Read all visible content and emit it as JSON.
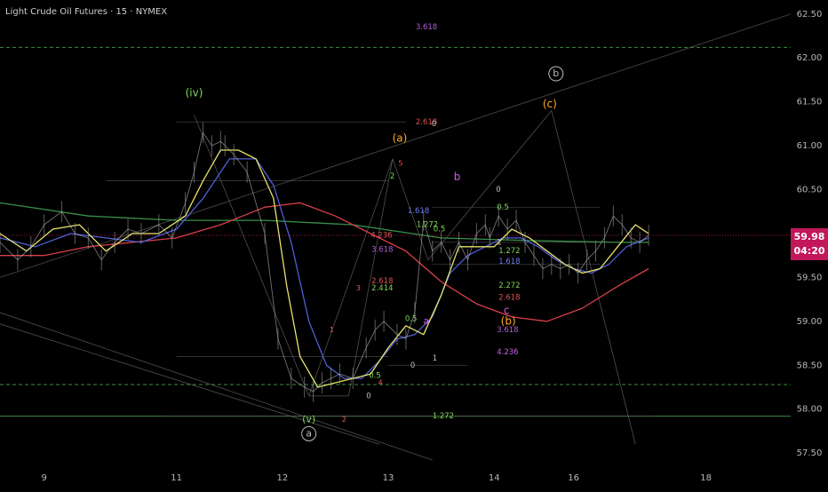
{
  "header": {
    "title": "Light Crude Oil Futures · 15 · NYMEX"
  },
  "price_tag": {
    "price": "59.98",
    "countdown": "04:20",
    "value": 59.98,
    "color": "#c2185b"
  },
  "colors": {
    "background": "#000000",
    "price": "#cfcfcf",
    "fast_ma": "#e8e36a",
    "mid_ma": "#4f5fd6",
    "slow_ma": "#d8404a",
    "long_ma": "#3a8f4a",
    "dashed_level": "#4caf50",
    "label_green": "#7ed957",
    "label_orange": "#ffa726",
    "label_pink": "#d05ce8",
    "label_red": "#ff5252",
    "label_gray": "#bdbdbd"
  },
  "chart_data": {
    "type": "line",
    "x_ticks": [
      "9",
      "11",
      "12",
      "13",
      "14",
      "16",
      "18"
    ],
    "x_tick_pos": [
      0.5,
      2.0,
      3.2,
      4.4,
      5.6,
      6.5,
      8.0
    ],
    "xlim": [
      0,
      8.96
    ],
    "ylim": [
      57.4,
      62.66
    ],
    "y_ticks": [
      "62.50",
      "62.00",
      "61.50",
      "61.00",
      "60.50",
      "59.50",
      "59.00",
      "58.50",
      "58.00",
      "57.50"
    ],
    "y_tick_values": [
      62.5,
      62.0,
      61.5,
      61.0,
      60.5,
      59.5,
      59.0,
      58.5,
      58.0,
      57.5
    ],
    "price": {
      "x": [
        0,
        0.2,
        0.35,
        0.5,
        0.7,
        0.85,
        1.0,
        1.15,
        1.3,
        1.45,
        1.6,
        1.8,
        1.95,
        2.1,
        2.2,
        2.3,
        2.4,
        2.5,
        2.55,
        2.65,
        2.8,
        3.0,
        3.15,
        3.3,
        3.45,
        3.55,
        3.65,
        3.75,
        3.85,
        4.0,
        4.15,
        4.25,
        4.35,
        4.5,
        4.6,
        4.7,
        4.8,
        4.9,
        5.0,
        5.1,
        5.2,
        5.3,
        5.4,
        5.5,
        5.55,
        5.65,
        5.75,
        5.85,
        5.95,
        6.05,
        6.15,
        6.25,
        6.35,
        6.45,
        6.55,
        6.65,
        6.75,
        6.85,
        6.95,
        7.05,
        7.15,
        7.25,
        7.35
      ],
      "y": [
        59.9,
        59.7,
        59.85,
        60.1,
        60.25,
        60.0,
        59.95,
        59.7,
        59.9,
        60.05,
        60.0,
        60.1,
        59.95,
        60.35,
        60.7,
        61.15,
        61.0,
        61.05,
        61.0,
        60.9,
        60.7,
        60.0,
        58.8,
        58.35,
        58.25,
        58.2,
        58.3,
        58.35,
        58.4,
        58.35,
        58.7,
        58.9,
        59.0,
        58.85,
        58.8,
        59.1,
        60.15,
        59.8,
        59.9,
        59.7,
        59.9,
        59.7,
        60.0,
        60.1,
        59.95,
        60.2,
        60.05,
        60.15,
        59.9,
        59.75,
        59.6,
        59.65,
        59.6,
        59.65,
        59.55,
        59.7,
        59.8,
        59.95,
        60.2,
        60.1,
        59.95,
        59.9,
        59.98
      ]
    },
    "series": [
      {
        "x": [
          0,
          0.3,
          0.6,
          0.9,
          1.2,
          1.5,
          1.8,
          2.1,
          2.3,
          2.5,
          2.7,
          2.9,
          3.1,
          3.25,
          3.4,
          3.6,
          3.8,
          4.0,
          4.2,
          4.4,
          4.6,
          4.8,
          5.0,
          5.2,
          5.4,
          5.6,
          5.8,
          6.0,
          6.2,
          6.4,
          6.6,
          6.8,
          7.0,
          7.2,
          7.35
        ],
        "y": [
          60.0,
          59.8,
          60.05,
          60.1,
          59.8,
          60.0,
          60.0,
          60.2,
          60.6,
          60.95,
          60.95,
          60.85,
          60.4,
          59.4,
          58.6,
          58.25,
          58.3,
          58.35,
          58.4,
          58.7,
          58.95,
          58.85,
          59.3,
          59.85,
          59.85,
          59.85,
          60.05,
          59.95,
          59.8,
          59.65,
          59.55,
          59.6,
          59.85,
          60.1,
          60.0
        ]
      },
      {
        "x": [
          0,
          0.4,
          0.8,
          1.2,
          1.6,
          2.0,
          2.3,
          2.6,
          2.9,
          3.1,
          3.3,
          3.5,
          3.7,
          3.9,
          4.1,
          4.3,
          4.5,
          4.7,
          4.9,
          5.1,
          5.3,
          5.5,
          5.7,
          5.9,
          6.1,
          6.3,
          6.5,
          6.7,
          6.9,
          7.1,
          7.35
        ],
        "y": [
          59.95,
          59.85,
          60.0,
          59.95,
          59.9,
          60.05,
          60.4,
          60.85,
          60.85,
          60.55,
          59.9,
          59.0,
          58.5,
          58.35,
          58.35,
          58.55,
          58.8,
          58.85,
          59.05,
          59.55,
          59.75,
          59.85,
          59.95,
          59.95,
          59.85,
          59.7,
          59.6,
          59.55,
          59.65,
          59.85,
          59.95
        ]
      },
      {
        "x": [
          0,
          0.5,
          1.0,
          1.5,
          2.0,
          2.5,
          3.0,
          3.4,
          3.8,
          4.2,
          4.6,
          5.0,
          5.4,
          5.8,
          6.2,
          6.6,
          7.0,
          7.35
        ],
        "y": [
          59.75,
          59.75,
          59.85,
          59.9,
          59.95,
          60.1,
          60.3,
          60.35,
          60.2,
          60.0,
          59.8,
          59.45,
          59.2,
          59.05,
          59.0,
          59.15,
          59.4,
          59.6
        ]
      },
      {
        "x": [
          0,
          1.0,
          2.0,
          3.0,
          4.0,
          5.0,
          6.0,
          7.0,
          7.35
        ],
        "y": [
          60.35,
          60.2,
          60.15,
          60.15,
          60.1,
          59.95,
          59.92,
          59.9,
          59.9
        ]
      }
    ],
    "horizontal_levels": [
      {
        "y": 62.12,
        "style": "dashed",
        "color": "#4caf50"
      },
      {
        "y": 58.28,
        "style": "dashed",
        "color": "#4caf50"
      },
      {
        "y": 57.92,
        "style": "solid",
        "color": "#4caf50"
      },
      {
        "y": 59.98,
        "style": "dotted",
        "color": "#c2185b"
      }
    ],
    "wave_labels": [
      {
        "text": "(iv)",
        "x": 2.2,
        "y": 61.6,
        "color": "#7ed957",
        "size": 12
      },
      {
        "text": "(v)",
        "x": 3.5,
        "y": 57.88,
        "color": "#7ed957",
        "size": 11
      },
      {
        "text": "a",
        "x": 3.5,
        "y": 57.72,
        "color": "#bdbdbd",
        "size": 11,
        "circle": true
      },
      {
        "text": "(a)",
        "x": 4.53,
        "y": 61.08,
        "color": "#ffa726",
        "size": 12
      },
      {
        "text": "b",
        "x": 5.18,
        "y": 60.64,
        "color": "#d05ce8",
        "size": 12
      },
      {
        "text": "a",
        "x": 4.83,
        "y": 59.0,
        "color": "#d05ce8",
        "size": 11
      },
      {
        "text": "c",
        "x": 5.74,
        "y": 59.12,
        "color": "#d05ce8",
        "size": 12
      },
      {
        "text": "(b)",
        "x": 5.76,
        "y": 59.0,
        "color": "#ffa726",
        "size": 12
      },
      {
        "text": "(c)",
        "x": 6.23,
        "y": 61.47,
        "color": "#ffa726",
        "size": 12
      },
      {
        "text": "b",
        "x": 6.3,
        "y": 61.82,
        "color": "#bdbdbd",
        "size": 11,
        "circle": true
      },
      {
        "text": "1",
        "x": 3.76,
        "y": 58.9,
        "color": "#ff5252",
        "size": 8
      },
      {
        "text": "2",
        "x": 3.9,
        "y": 57.88,
        "color": "#ff5252",
        "size": 8
      },
      {
        "text": "3",
        "x": 4.06,
        "y": 59.38,
        "color": "#ff5252",
        "size": 8
      },
      {
        "text": "4",
        "x": 4.31,
        "y": 58.3,
        "color": "#ff5252",
        "size": 8
      },
      {
        "text": "5",
        "x": 4.54,
        "y": 60.8,
        "color": "#ff5252",
        "size": 8
      }
    ],
    "fib_labels": [
      {
        "text": "3.618",
        "x": 4.71,
        "y": 62.35,
        "color": "#b15cd6"
      },
      {
        "text": "2.618",
        "x": 4.71,
        "y": 61.27,
        "color": "#e05050"
      },
      {
        "text": "0",
        "x": 4.89,
        "y": 61.25,
        "color": "#bdbdbd"
      },
      {
        "text": "2",
        "x": 4.42,
        "y": 60.65,
        "color": "#7ed957"
      },
      {
        "text": "1.618",
        "x": 4.62,
        "y": 60.26,
        "color": "#6b7cf0"
      },
      {
        "text": "1.272",
        "x": 4.72,
        "y": 60.1,
        "color": "#7ed957"
      },
      {
        "text": "4.236",
        "x": 4.2,
        "y": 59.98,
        "color": "#e05050"
      },
      {
        "text": "3.618",
        "x": 4.21,
        "y": 59.82,
        "color": "#b15cd6"
      },
      {
        "text": "0.5",
        "x": 4.59,
        "y": 59.03,
        "color": "#7ed957"
      },
      {
        "text": "2.618",
        "x": 4.21,
        "y": 59.46,
        "color": "#e05050"
      },
      {
        "text": "2.414",
        "x": 4.21,
        "y": 59.38,
        "color": "#7ed957"
      },
      {
        "text": "0",
        "x": 4.65,
        "y": 58.5,
        "color": "#bdbdbd"
      },
      {
        "text": "1",
        "x": 4.9,
        "y": 58.58,
        "color": "#bdbdbd"
      },
      {
        "text": "0.5",
        "x": 4.18,
        "y": 58.38,
        "color": "#7ed957"
      },
      {
        "text": "0",
        "x": 4.15,
        "y": 58.15,
        "color": "#bdbdbd"
      },
      {
        "text": "1.272",
        "x": 4.9,
        "y": 57.92,
        "color": "#7ed957"
      },
      {
        "text": "0",
        "x": 5.62,
        "y": 60.5,
        "color": "#bdbdbd"
      },
      {
        "text": "0.5",
        "x": 5.63,
        "y": 60.3,
        "color": "#7ed957"
      },
      {
        "text": "0.5",
        "x": 4.91,
        "y": 60.05,
        "color": "#7ed957"
      },
      {
        "text": "1",
        "x": 5.63,
        "y": 59.9,
        "color": "#bdbdbd"
      },
      {
        "text": "1.272",
        "x": 5.65,
        "y": 59.8,
        "color": "#7ed957"
      },
      {
        "text": "1.618",
        "x": 5.65,
        "y": 59.68,
        "color": "#6b7cf0"
      },
      {
        "text": "2.272",
        "x": 5.65,
        "y": 59.41,
        "color": "#7ed957"
      },
      {
        "text": "2.618",
        "x": 5.65,
        "y": 59.27,
        "color": "#e05050"
      },
      {
        "text": "3.618",
        "x": 5.63,
        "y": 58.9,
        "color": "#b15cd6"
      },
      {
        "text": "4.236",
        "x": 5.63,
        "y": 58.65,
        "color": "#d05ce8"
      }
    ],
    "trend_lines": [
      {
        "x1": 0,
        "y1": 59.5,
        "x2": 8.96,
        "y2": 62.5
      },
      {
        "x1": 0,
        "y1": 59.1,
        "x2": 4.9,
        "y2": 57.42
      },
      {
        "x1": 0,
        "y1": 58.97,
        "x2": 4.3,
        "y2": 57.6
      },
      {
        "x1": 2.2,
        "y1": 61.35,
        "x2": 3.5,
        "y2": 58.15
      },
      {
        "x1": 3.5,
        "y1": 58.15,
        "x2": 4.45,
        "y2": 60.85
      },
      {
        "x1": 4.45,
        "y1": 60.85,
        "x2": 4.85,
        "y2": 59.7
      },
      {
        "x1": 4.85,
        "y1": 59.7,
        "x2": 6.25,
        "y2": 61.4
      },
      {
        "x1": 6.25,
        "y1": 61.4,
        "x2": 7.2,
        "y2": 57.6
      },
      {
        "x1": 3.5,
        "y1": 58.15,
        "x2": 3.95,
        "y2": 58.15
      },
      {
        "x1": 3.95,
        "y1": 58.15,
        "x2": 4.45,
        "y2": 60.85
      }
    ],
    "fib_lines": [
      {
        "y": 61.27,
        "x1": 2.0,
        "x2": 4.6
      },
      {
        "y": 60.6,
        "x1": 1.2,
        "x2": 4.4
      },
      {
        "y": 58.6,
        "x1": 2.0,
        "x2": 4.4
      },
      {
        "y": 58.5,
        "x1": 4.4,
        "x2": 5.3
      },
      {
        "y": 60.3,
        "x1": 4.9,
        "x2": 6.8
      },
      {
        "y": 59.9,
        "x1": 4.9,
        "x2": 6.8
      },
      {
        "y": 59.65,
        "x1": 4.9,
        "x2": 6.8
      },
      {
        "y": 57.92,
        "x1": 1.85,
        "x2": 7.4
      }
    ]
  }
}
